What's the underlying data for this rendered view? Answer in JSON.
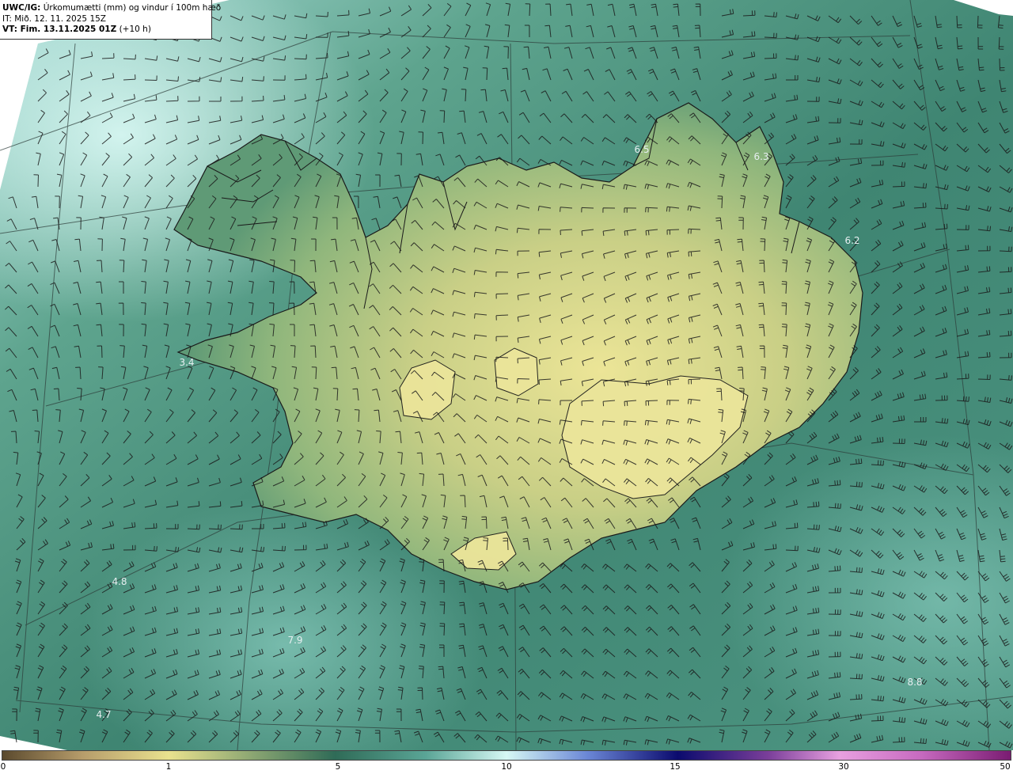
{
  "info": {
    "product": "UWC/IG:",
    "title": "Úrkomumætti (mm) og vindur í 100m hæð",
    "issue_time": "IT: Mið. 12. 11. 2025 15Z",
    "valid_time_label": "VT: Fim. 13.11.2025 01Z",
    "valid_time_offset": "(+10 h)"
  },
  "map_labels": [
    {
      "text": "6.5"
    },
    {
      "text": "6.3"
    },
    {
      "text": "6.2"
    },
    {
      "text": "3.4"
    },
    {
      "text": "4.8"
    },
    {
      "text": "7.9"
    },
    {
      "text": "4.7"
    },
    {
      "text": "8.8"
    }
  ],
  "colorbar": {
    "ticks": [
      "0",
      "1",
      "5",
      "10",
      "15",
      "30",
      "50"
    ],
    "colors": {
      "brown": "#8a6f4a",
      "yellow": "#e9e28e",
      "green": "#2f6b57",
      "teal": "#5aa596",
      "cyan": "#cff6f2",
      "blue": "#3558b8",
      "navy": "#0b0b6e",
      "purple": "#7b3f9a",
      "pink": "#e8a0e0",
      "magenta": "#9b2a8c"
    }
  },
  "theme": {
    "land_high": "#e3dd8c",
    "land_mid": "#8fb87a",
    "sea": "#3d8470",
    "sea_light": "#7ec3b4",
    "coast": "#1a1a1a"
  }
}
